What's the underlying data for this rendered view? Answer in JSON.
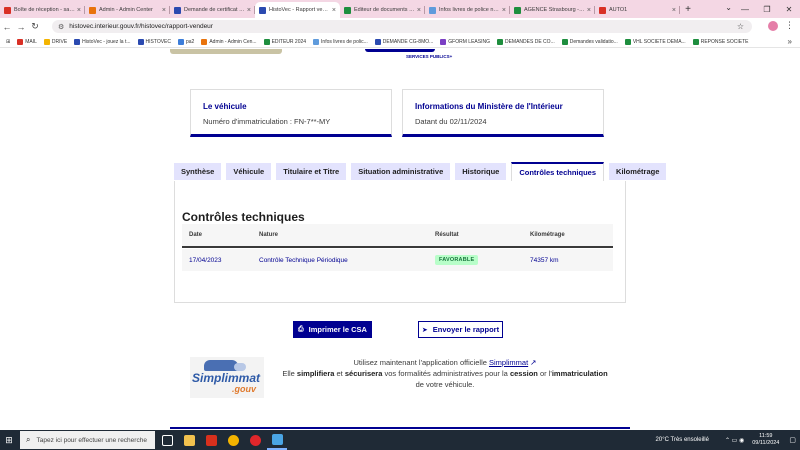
{
  "browser": {
    "tabs": [
      {
        "title": "Boîte de réception - sam...",
        "color": "#d93025"
      },
      {
        "title": "Admin - Admin Center",
        "color": "#e8730c"
      },
      {
        "title": "Demande de certificat de...",
        "color": "#2b4ab0"
      },
      {
        "title": "HistoVec - Rapport vende...",
        "color": "#2b4ab0",
        "active": true
      },
      {
        "title": "Editeur de documents de...",
        "color": "#1e8e3e"
      },
      {
        "title": "Infos livres de police num...",
        "color": "#5f9bdc"
      },
      {
        "title": "AGENCE Strasbourg - Go...",
        "color": "#1e8e3e"
      },
      {
        "title": "AUTO1",
        "color": "#d93025"
      }
    ],
    "url": "histovec.interieur.gouv.fr/histovec/rapport-vendeur",
    "bookmarks": [
      {
        "label": "MAIL",
        "color": "#d93025"
      },
      {
        "label": "DRIVE",
        "color": "#f4b400"
      },
      {
        "label": "HistoVec - jouez la t...",
        "color": "#2b4ab0"
      },
      {
        "label": "HISTOVEC",
        "color": "#2b4ab0"
      },
      {
        "label": "pa2",
        "color": "#3c7dd9"
      },
      {
        "label": "Admin - Admin Cen...",
        "color": "#e8730c"
      },
      {
        "label": "EDITEUR 2024",
        "color": "#1e8e3e"
      },
      {
        "label": "Infos livres de polic...",
        "color": "#5f9bdc"
      },
      {
        "label": "DEMANDE CG-8MO...",
        "color": "#2b4ab0"
      },
      {
        "label": "GFORM LEASING",
        "color": "#7b3fc4"
      },
      {
        "label": "DEMANDES DE CO...",
        "color": "#1e8e3e"
      },
      {
        "label": "Demandes validatio...",
        "color": "#1e8e3e"
      },
      {
        "label": "VHL SOCIETE DEMA...",
        "color": "#1e8e3e"
      },
      {
        "label": "REPONSE SOCIETE",
        "color": "#1e8e3e"
      }
    ]
  },
  "header": {
    "service_logo": "SERVICES PUBLICS+"
  },
  "cards": {
    "vehicle": {
      "title": "Le véhicule",
      "text": "Numéro d'immatriculation : FN-7**-MY"
    },
    "ministry": {
      "title": "Informations du Ministère de l'Intérieur",
      "text": "Datant du 02/11/2024"
    }
  },
  "report_tabs": [
    {
      "label": "Synthèse"
    },
    {
      "label": "Véhicule"
    },
    {
      "label": "Titulaire et Titre"
    },
    {
      "label": "Situation administrative"
    },
    {
      "label": "Historique"
    },
    {
      "label": "Contrôles techniques",
      "active": true
    },
    {
      "label": "Kilométrage"
    }
  ],
  "controls": {
    "heading": "Contrôles techniques",
    "columns": [
      "Date",
      "Nature",
      "Résultat",
      "Kilométrage"
    ],
    "rows": [
      {
        "date": "17/04/2023",
        "nature": "Contrôle Technique Périodique",
        "result": "FAVORABLE",
        "mileage": "74357 km"
      }
    ]
  },
  "actions": {
    "print_label": "Imprimer le CSA",
    "send_label": "Envoyer le rapport"
  },
  "simplimmat": {
    "logo_name": "Simplimmat",
    "logo_gouv": ".gouv",
    "line1_prefix": "Utilisez maintenant l'application officielle ",
    "link": "Simplimmat",
    "line2_a": "Elle ",
    "bold1": "simplifiera",
    "line2_b": " et ",
    "bold2": "sécurisera",
    "line2_c": " vos formalités administratives pour la ",
    "bold3": "cession",
    "line2_d": " or l'",
    "bold4": "immatriculation",
    "line2_e": " de votre véhicule."
  },
  "taskbar": {
    "search_placeholder": "Tapez ici pour effectuer une recherche",
    "weather": "20°C  Très ensoleillé",
    "time": "11:59",
    "date": "09/11/2024"
  }
}
